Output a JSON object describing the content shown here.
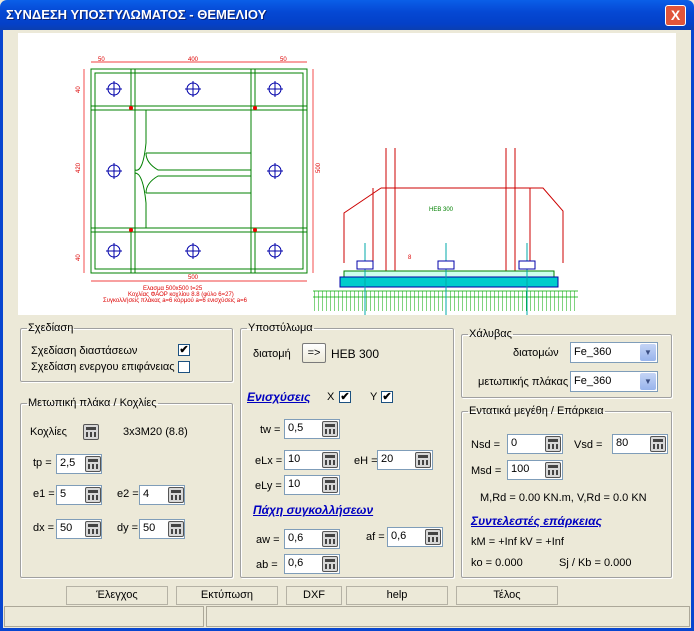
{
  "window": {
    "title": "ΣΥΝΔΕΣΗ ΥΠΟΣΤΥΛΩΜΑΤΟΣ - ΘΕΜΕΛΙΟΥ",
    "close_label": "X"
  },
  "drawing": {
    "plan_dims": {
      "top_left": "50",
      "top_mid": "400",
      "top_right": "50",
      "bottom": "500",
      "left": "420",
      "right": "500",
      "small1": "40",
      "small2": "40"
    },
    "plan_notes": [
      "Ελασμα 500x500 t=25",
      "Κοχλίας ΦΑΟΡ κοχλίου 8.8 (φύλο 6=27)",
      "Συγκολλήσεις πλάκας a=6 κορμού a=6 ενισχύσεις a=6"
    ],
    "profile_label": "HEB 300",
    "elev_dim": "8"
  },
  "schediasi": {
    "legend": "Σχεδίαση",
    "dims_label": "Σχεδίαση διαστάσεων",
    "dims_checked": "✔",
    "surface_label": "Σχεδίαση ενεργου επιφάνειας",
    "surface_checked": ""
  },
  "plate": {
    "legend": "Μετωπική πλάκα / Κοχλίες",
    "bolts_label": "Κοχλίες",
    "bolts_value": "3x3M20 (8.8)",
    "tp_label": "tp =",
    "tp": "2,5",
    "e1_label": "e1 =",
    "e1": "5",
    "e2_label": "e2 =",
    "e2": "4",
    "dx_label": "dx =",
    "dx": "50",
    "dy_label": "dy =",
    "dy": "50"
  },
  "column": {
    "legend": "Υποστύλωμα",
    "section_label": "διατομή",
    "section_btn": "=>",
    "section": "HEB 300",
    "stiffeners_label": "Ενισχύσεις",
    "x_label": "X",
    "x_checked": "✔",
    "y_label": "Y",
    "y_checked": "✔",
    "tw_label": "tw =",
    "tw": "0,5",
    "elx_label": "eLx =",
    "elx": "10",
    "eh_label": "eH =",
    "eh": "20",
    "ely_label": "eLy =",
    "ely": "10",
    "welds_label": "Πάχη συγκολλήσεων",
    "aw_label": "aw =",
    "aw": "0,6",
    "af_label": "af =",
    "af": "0,6",
    "ab_label": "ab =",
    "ab": "0,6"
  },
  "steel": {
    "legend": "Χάλυβας",
    "sections_label": "διατομών",
    "sections": "Fe_360",
    "plate_label": "μετωπικής πλάκας",
    "plate": "Fe_360"
  },
  "forces": {
    "legend": "Εντατικά μεγέθη / Επάρκεια",
    "nsd_label": "Nsd =",
    "nsd": "0",
    "vsd_label": "Vsd =",
    "vsd": "80",
    "msd_label": "Msd =",
    "msd": "100",
    "result_m": "M,Rd = 0.00 KN.m,",
    "result_v": "V,Rd = 0.0 KN",
    "coef_label": "Συντελεστές επάρκειας",
    "km": "kM = +Inf  kV = +Inf",
    "ko": "ko = 0.000",
    "sj": "Sj / Kb = 0.000"
  },
  "buttons": {
    "check": "Έλεγχος",
    "print": "Εκτύπωση",
    "dxf": "DXF",
    "help": "help",
    "end": "Τέλος"
  }
}
